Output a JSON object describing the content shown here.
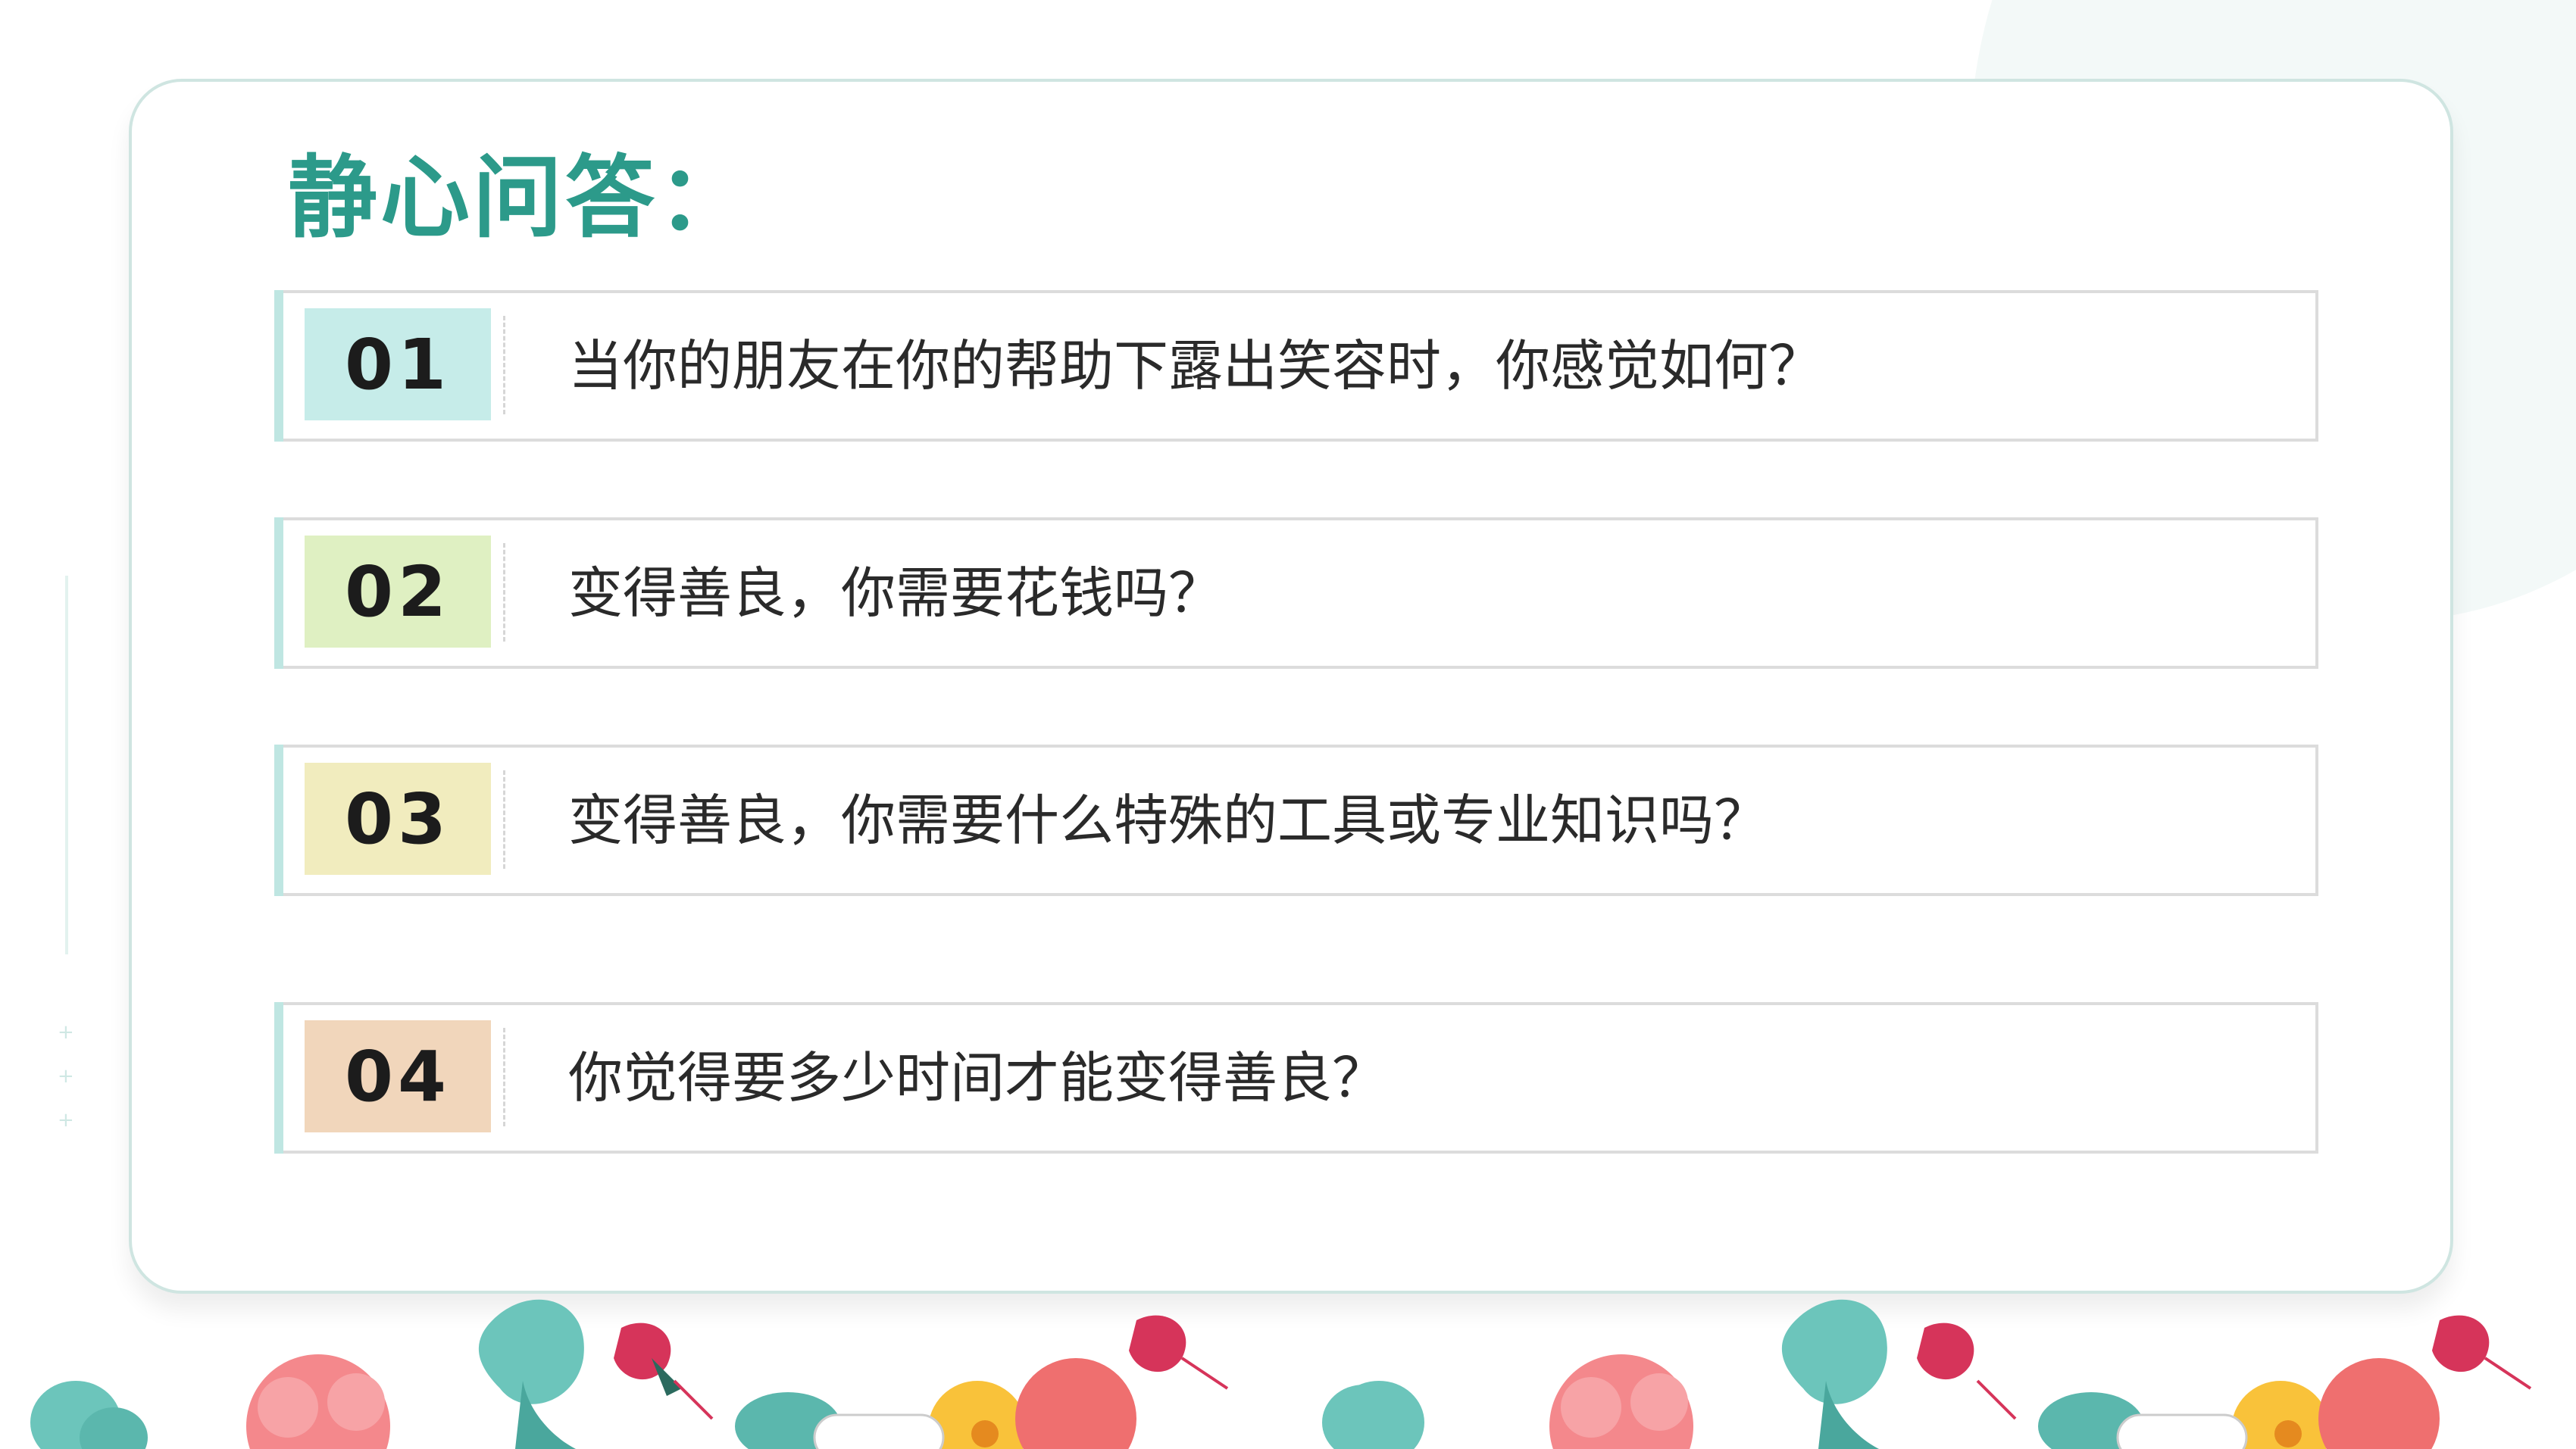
{
  "title": "静心问答：",
  "questions": [
    {
      "number": "01",
      "text": "当你的朋友在你的帮助下露出笑容时，你感觉如何？",
      "box_color": "#c6ece9"
    },
    {
      "number": "02",
      "text": "变得善良，你需要花钱吗？",
      "box_color": "#dff0c2"
    },
    {
      "number": "03",
      "text": "变得善良，你需要什么特殊的工具或专业知识吗？",
      "box_color": "#f1ecbe"
    },
    {
      "number": "04",
      "text": "你觉得要多少时间才能变得善良？",
      "box_color": "#f1d6bb"
    }
  ],
  "colors": {
    "title": "#2c9a8a",
    "card_border": "#cfe5e1",
    "row_border": "#dcdcdc",
    "accent_bar": "#bfe6e2"
  },
  "decoration": "floral-border"
}
